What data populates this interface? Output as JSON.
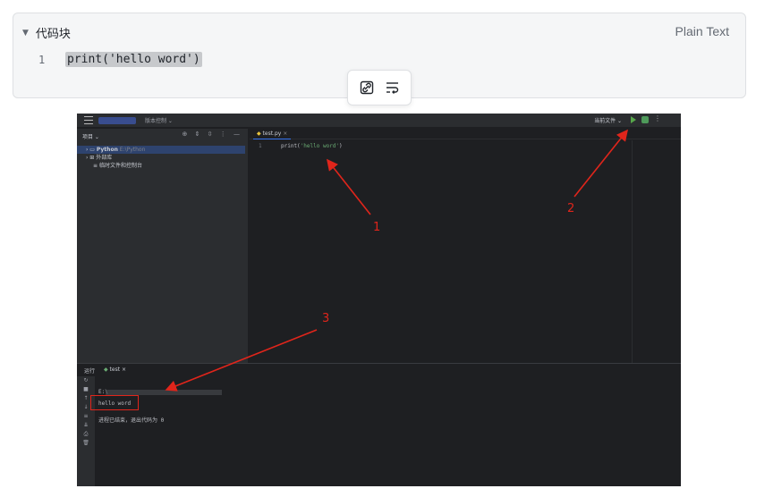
{
  "codeblock": {
    "title": "代码块",
    "language": "Plain Text",
    "line_number": "1",
    "code": "print('hello word')",
    "toolbar": {
      "icons": [
        "link-icon",
        "wrap-icon"
      ]
    }
  },
  "ide": {
    "toolbar": {
      "vcs_label": "版本控制 ⌄",
      "run_config": "当前文件 ⌄"
    },
    "project_panel": {
      "title": "项目 ⌄",
      "rows": [
        {
          "label": "Python",
          "detail": "E:\\Python"
        },
        {
          "label": "外部库",
          "detail": ""
        },
        {
          "label": "临时文件和控制台",
          "detail": ""
        }
      ]
    },
    "editor": {
      "tab": "test.py",
      "line_number": "1",
      "code_prefix": "print(",
      "code_string": "'hello word'",
      "code_suffix": ")"
    },
    "run_panel": {
      "title": "运行",
      "tab": "test",
      "output_line1": "E:\\",
      "output_hello": "hello word",
      "output_exit": "进程已结束，退出代码为 0"
    }
  },
  "annotations": {
    "n1": "1",
    "n2": "2",
    "n3": "3"
  },
  "colors": {
    "annotation": "#e0251b",
    "ide_bg": "#1e1f22",
    "panel_bg": "#2b2d30",
    "string_green": "#6aab73"
  }
}
